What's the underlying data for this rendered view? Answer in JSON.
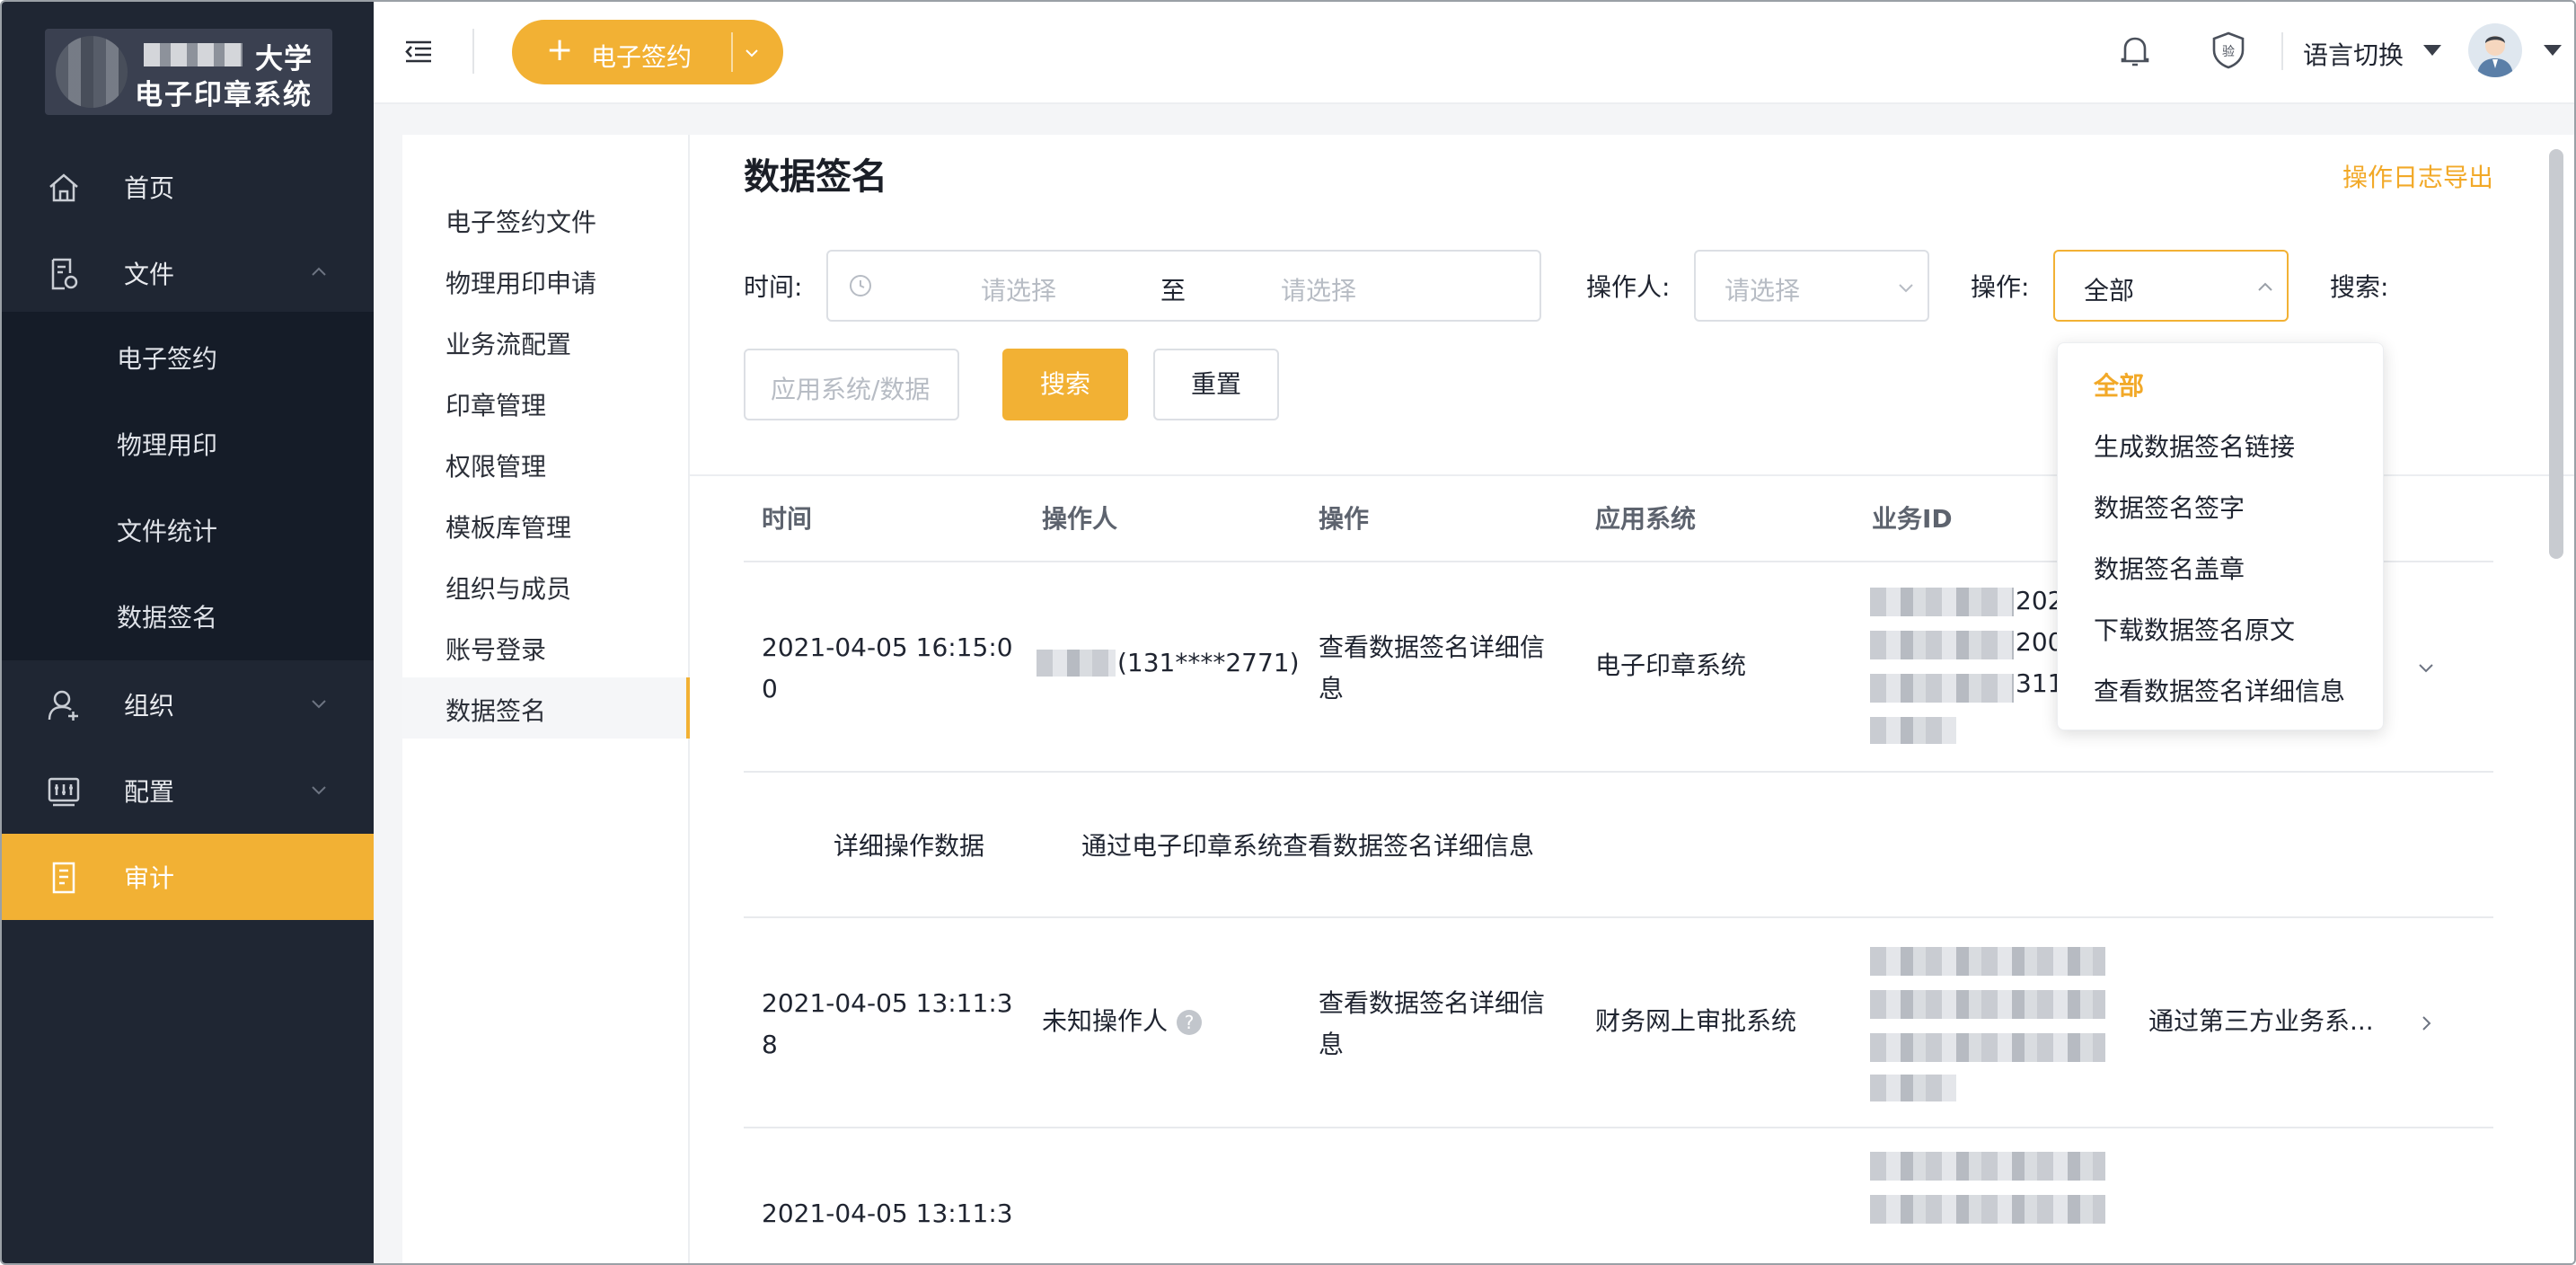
{
  "sidebar": {
    "logo": {
      "line1": "大学",
      "line2": "电子印章系统"
    },
    "menu": [
      {
        "label": "首页",
        "icon": "home-icon"
      },
      {
        "label": "文件",
        "icon": "file-icon"
      },
      {
        "label": "组织",
        "icon": "organization-icon"
      },
      {
        "label": "配置",
        "icon": "config-icon"
      },
      {
        "label": "审计",
        "icon": "audit-icon"
      }
    ],
    "file_submenu": [
      "电子签约",
      "物理用印",
      "文件统计",
      "数据签名"
    ]
  },
  "topbar": {
    "esign_button": "电子签约",
    "language": "语言切换"
  },
  "subnav": [
    "电子签约文件",
    "物理用印申请",
    "业务流配置",
    "印章管理",
    "权限管理",
    "模板库管理",
    "组织与成员",
    "账号登录",
    "数据签名"
  ],
  "page": {
    "title": "数据签名",
    "export": "操作日志导出"
  },
  "filters": {
    "time_label": "时间:",
    "start_placeholder": "请选择",
    "range_sep": "至",
    "end_placeholder": "请选择",
    "operator_label": "操作人:",
    "operator_placeholder": "请选择",
    "operation_label": "操作:",
    "operation_value": "全部",
    "search_label": "搜索:",
    "search_placeholder": "应用系统/数据",
    "search_button": "搜索",
    "reset_button": "重置"
  },
  "table": {
    "headers": [
      "时间",
      "操作人",
      "操作",
      "应用系统",
      "业务ID"
    ],
    "rows": [
      {
        "time": [
          "2021-04-05 16:15:0",
          "0"
        ],
        "operator_phone": "(131****2771)",
        "operation": [
          "查看数据签名详细信",
          "息"
        ],
        "app": "电子印章系统",
        "bizid_visible": [
          "202",
          "200",
          "311"
        ]
      },
      {
        "time": [
          "2021-04-05 13:11:3",
          "8"
        ],
        "operator": "未知操作人",
        "operation": [
          "查看数据签名详细信",
          "息"
        ],
        "app": "财务网上审批系统",
        "extra": "通过第三方业务系..."
      },
      {
        "time": [
          "2021-04-05 13:11:3"
        ]
      }
    ],
    "detail": {
      "label": "详细操作数据",
      "value": "通过电子印章系统查看数据签名详细信息"
    }
  },
  "operation_dropdown": {
    "options": [
      "全部",
      "生成数据签名链接",
      "数据签名签字",
      "数据签名盖章",
      "下载数据签名原文",
      "查看数据签名详细信息"
    ],
    "selected": "全部"
  },
  "colors": {
    "accent": "#f2b134",
    "sidebar": "#1f2633"
  }
}
